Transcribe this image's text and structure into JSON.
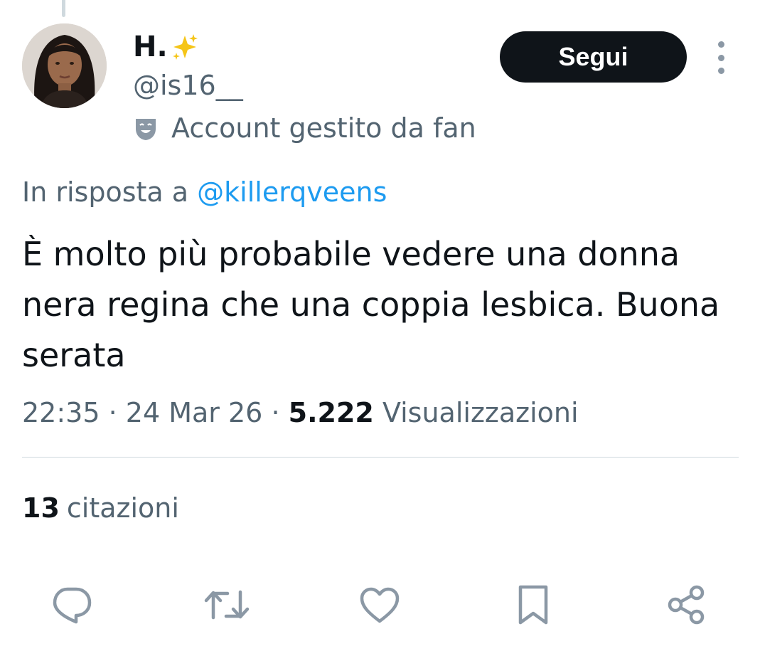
{
  "author": {
    "display_name": "H.",
    "name_emoji": "sparkles-icon",
    "handle": "@is16__",
    "fan_account_label": "Account gestito da fan",
    "fan_account_icon": "theater-mask-icon"
  },
  "header": {
    "follow_label": "Segui",
    "more_icon": "more-vertical-icon"
  },
  "reply": {
    "prefix": "In risposta a",
    "mention": "@killerqveens"
  },
  "tweet": {
    "text": "È molto più probabile vedere una donna nera regina che una coppia lesbica. Buona serata"
  },
  "meta": {
    "time": "22:35",
    "separator": "·",
    "date": "24 Mar 26",
    "views_count": "5.222",
    "views_label": "Visualizzazioni"
  },
  "stats": {
    "quotes_count": "13",
    "quotes_label": "citazioni"
  },
  "actions": [
    {
      "icon": "reply-icon"
    },
    {
      "icon": "retweet-icon"
    },
    {
      "icon": "like-icon"
    },
    {
      "icon": "bookmark-icon"
    },
    {
      "icon": "share-icon"
    }
  ],
  "colors": {
    "text_primary": "#0f1419",
    "text_secondary": "#536471",
    "link": "#1d9bf0",
    "divider": "#cfd9de",
    "icon": "#8b98a5",
    "button_bg": "#0f1419"
  }
}
